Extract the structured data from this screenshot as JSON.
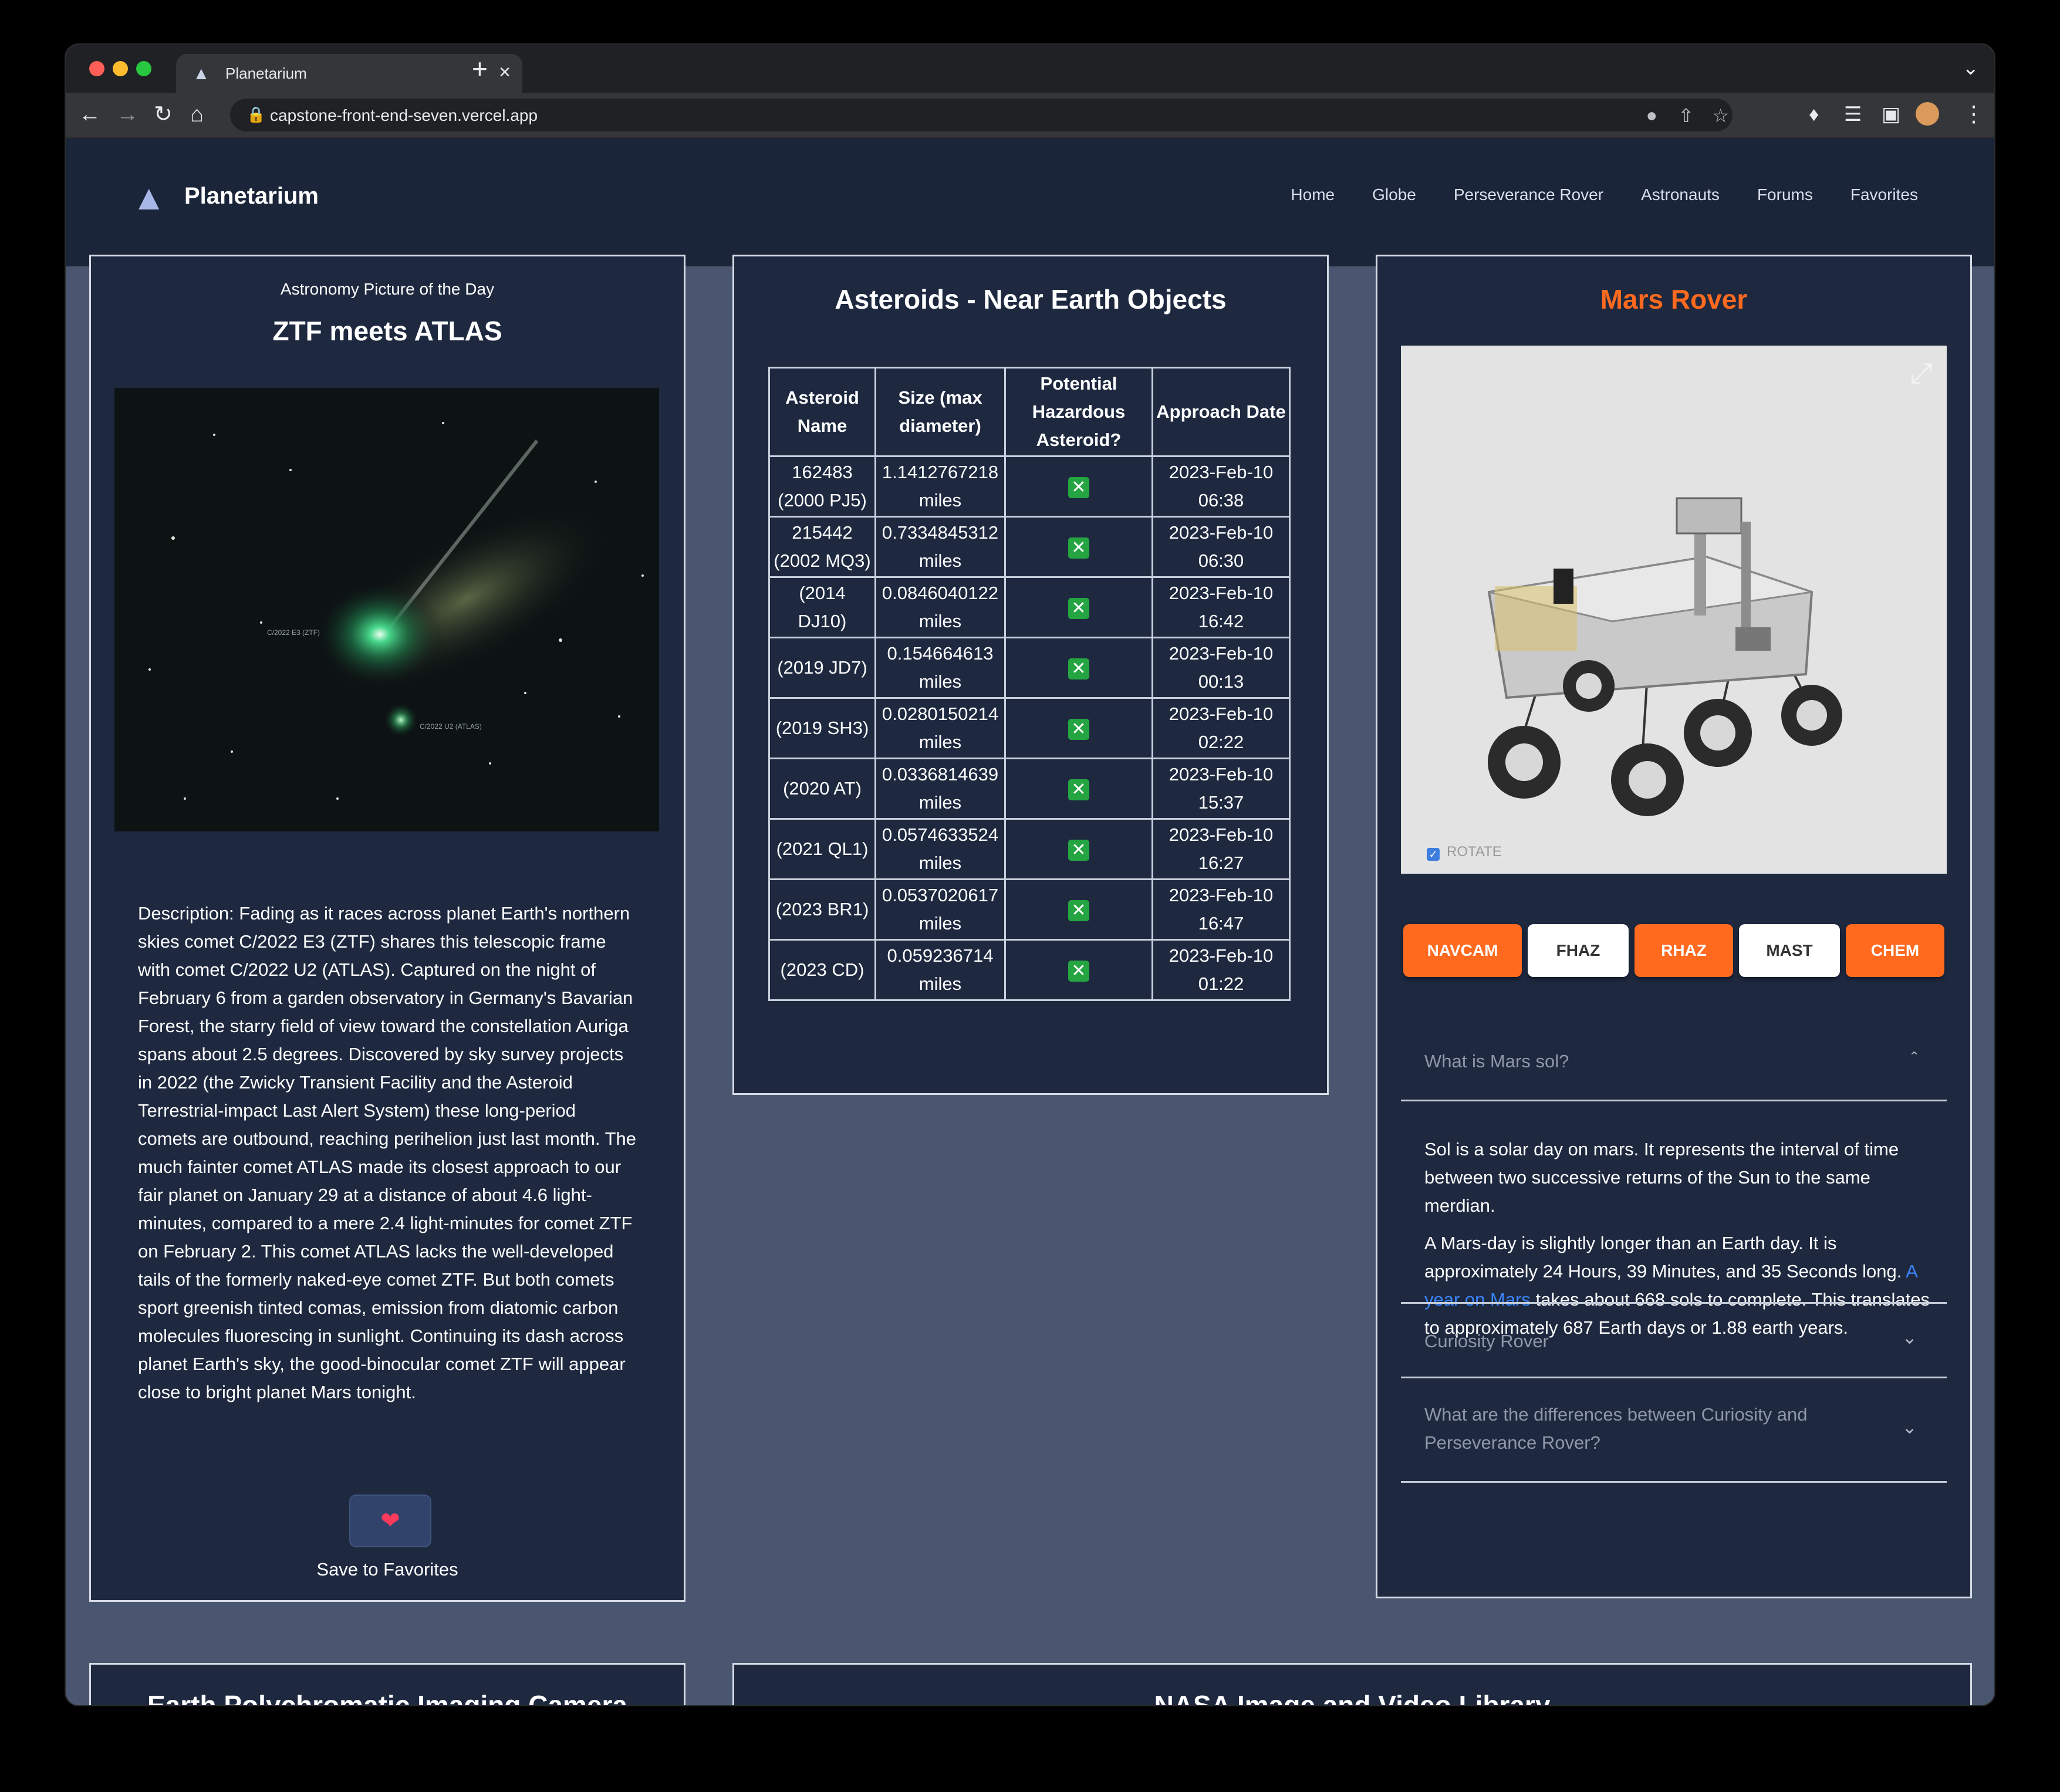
{
  "browser": {
    "tab_title": "Planetarium",
    "url": "capstone-front-end-seven.vercel.app"
  },
  "site": {
    "brand": "Planetarium",
    "nav": [
      "Home",
      "Globe",
      "Perseverance Rover",
      "Astronauts",
      "Forums",
      "Favorites"
    ]
  },
  "apod": {
    "subtitle": "Astronomy Picture of the Day",
    "title": "ZTF meets ATLAS",
    "image_labels": [
      "C/2022 E3 (ZTF)",
      "C/2022 U2 (ATLAS)"
    ],
    "description": "Description: Fading as it races across planet Earth's northern skies comet C/2022 E3 (ZTF) shares this telescopic frame with comet C/2022 U2 (ATLAS). Captured on the night of February 6 from a garden observatory in Germany's Bavarian Forest, the starry field of view toward the constellation Auriga spans about 2.5 degrees. Discovered by sky survey projects in 2022 (the Zwicky Transient Facility and the Asteroid Terrestrial-impact Last Alert System) these long-period comets are outbound, reaching perihelion just last month. The much fainter comet ATLAS made its closest approach to our fair planet on January 29 at a distance of about 4.6 light-minutes, compared to a mere 2.4 light-minutes for comet ZTF on February 2. This comet ATLAS lacks the well-developed tails of the formerly naked-eye comet ZTF. But both comets sport greenish tinted comas, emission from diatomic carbon molecules fluorescing in sunlight. Continuing its dash across planet Earth's sky, the good-binocular comet ZTF will appear close to bright planet Mars tonight.",
    "save_label": "Save to Favorites"
  },
  "neo": {
    "title": "Asteroids - Near Earth Objects",
    "headers": [
      "Asteroid Name",
      "Size (max diameter)",
      "Potential Hazardous Asteroid?",
      "Approach Date"
    ],
    "rows": [
      {
        "name": "162483 (2000 PJ5)",
        "size": "1.1412767218 miles",
        "date": "2023-Feb-10 06:38"
      },
      {
        "name": "215442 (2002 MQ3)",
        "size": "0.7334845312 miles",
        "date": "2023-Feb-10 06:30"
      },
      {
        "name": "(2014 DJ10)",
        "size": "0.0846040122 miles",
        "date": "2023-Feb-10 16:42"
      },
      {
        "name": "(2019 JD7)",
        "size": "0.154664613 miles",
        "date": "2023-Feb-10 00:13"
      },
      {
        "name": "(2019 SH3)",
        "size": "0.0280150214 miles",
        "date": "2023-Feb-10 02:22"
      },
      {
        "name": "(2020 AT)",
        "size": "0.0336814639 miles",
        "date": "2023-Feb-10 15:37"
      },
      {
        "name": "(2021 QL1)",
        "size": "0.0574633524 miles",
        "date": "2023-Feb-10 16:27"
      },
      {
        "name": "(2023 BR1)",
        "size": "0.0537020617 miles",
        "date": "2023-Feb-10 16:47"
      },
      {
        "name": "(2023 CD)",
        "size": "0.059236714 miles",
        "date": "2023-Feb-10 01:22"
      }
    ]
  },
  "rover": {
    "title": "Mars Rover",
    "rotate_label": "ROTATE",
    "cameras": [
      "NAVCAM",
      "FHAZ",
      "RHAZ",
      "MAST",
      "CHEM"
    ],
    "faq": [
      {
        "q": "What is Mars sol?",
        "expanded": true
      },
      {
        "q": "Curiosity Rover",
        "expanded": false
      },
      {
        "q": "What are the differences between Curiosity and Perseverance Rover?",
        "expanded": false
      }
    ],
    "sol_p1": "Sol is a solar day on mars. It represents the interval of time between two successive returns of the Sun to the same merdian.",
    "sol_p2_a": "A Mars-day is slightly longer than an Earth day. It is approximately 24 Hours, 39 Minutes, and 35 Seconds long.",
    "sol_link": "A year on Mars",
    "sol_p2_b": "takes about 668 sols to complete. This translates to approximately 687 Earth days or 1.88 earth years."
  },
  "bottom": {
    "left_title": "Earth Polychromatic Imaging Camera",
    "right_title": "NASA Image and Video Library"
  },
  "colors": {
    "accent": "#ff6a1f",
    "nav_bg": "#1b253a",
    "card_bg": "#1e2940",
    "page_bg": "#4a5670",
    "hazard_false": "#25a442"
  }
}
